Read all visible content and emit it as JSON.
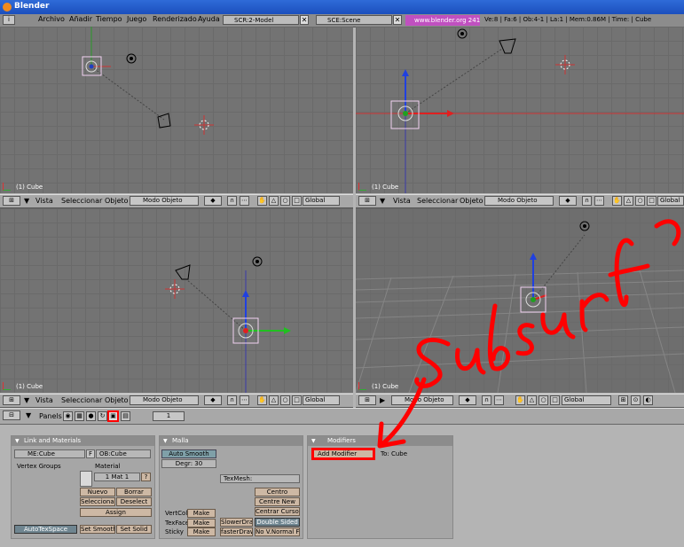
{
  "window": {
    "title": "Blender"
  },
  "menu": {
    "items": [
      "Archivo",
      "Añadir",
      "Tiempo",
      "Juego",
      "Renderizado",
      "Ayuda"
    ]
  },
  "info": {
    "screen": "SCR:2-Model",
    "scene": "SCE:Scene",
    "url": "www.blender.org 241",
    "stats": "Ve:8 | Fa:6 | Ob:4-1 | La:1 | Mem:0.86M | Time: | Cube"
  },
  "viewports": [
    {
      "label": "(1) Cube"
    },
    {
      "label": "(1) Cube"
    },
    {
      "label": "(1) Cube"
    },
    {
      "label": "(1) Cube"
    }
  ],
  "view_header": {
    "view": "Vista",
    "select": "Seleccionar",
    "object": "Objeto",
    "mode": "Modo Objeto",
    "orientation": "Global"
  },
  "props_header": {
    "panels": "Panels",
    "frame": "1"
  },
  "link_materials": {
    "title": "Link and Materials",
    "mesh": "ME:Cube",
    "f": "F",
    "ob": "OB:Cube",
    "vertex_groups": "Vertex Groups",
    "material": "Material",
    "mat_field": "1 Mat 1",
    "q": "?",
    "nuevo": "Nuevo",
    "borrar": "Borrar",
    "seleccionar": "Seleccionar",
    "deselect": "Deselect",
    "assign": "Assign",
    "autotex": "AutoTexSpace",
    "set_smooth": "Set Smooth",
    "set_solid": "Set Solid"
  },
  "malla": {
    "title": "Malla",
    "auto_smooth": "Auto Smooth",
    "degr": "Degr: 30",
    "texmesh": "TexMesh:",
    "centro": "Centro",
    "centre_new": "Centre New",
    "centrar_cursor": "Centrar Cursor",
    "vertcol": "VertCol",
    "texface": "TexFace",
    "sticky": "Sticky",
    "make": "Make",
    "slower_draw": "SlowerDra",
    "faster_draw": "fasterDraw",
    "double_sided": "Double Sided",
    "no_vnormal": "No V.Normal Fli"
  },
  "modifiers": {
    "title": "Modifiers",
    "add": "Add Modifier",
    "to": "To: Cube"
  },
  "annotation": {
    "color": "#ff0000",
    "text_hint": "Subsurf"
  },
  "colors": {
    "accent": "#c050c0",
    "title_bar": "#1b4fbd",
    "viewport": "#737373"
  }
}
